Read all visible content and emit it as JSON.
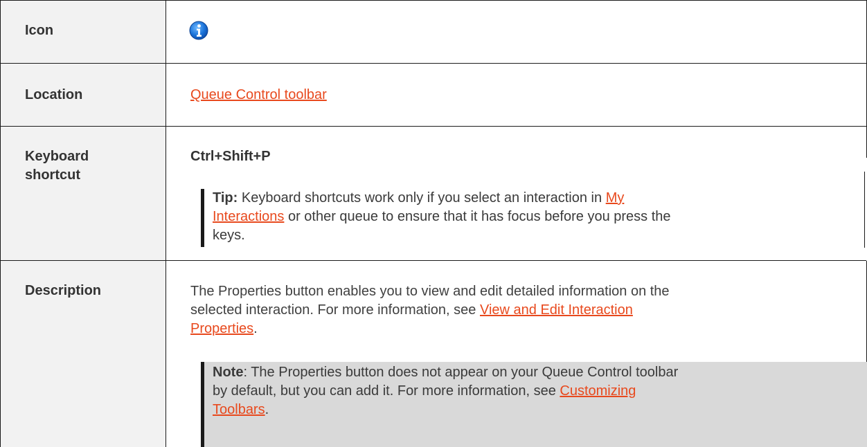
{
  "rows": {
    "icon": {
      "label": "Icon",
      "icon_name": "info-icon"
    },
    "location": {
      "label": "Location",
      "link": "Queue Control toolbar"
    },
    "shortcut": {
      "label_line1": "Keyboard",
      "label_line2": "shortcut",
      "keys": "Ctrl+Shift+P",
      "tip_label": "Tip:",
      "tip_text_1": "Keyboard shortcuts work only if you select an interaction in",
      "tip_link_1": "My",
      "tip_link_2": "Interactions",
      "tip_text_2": "or other queue to ensure that it has focus before you press the",
      "tip_text_3": "keys."
    },
    "description": {
      "label": "Description",
      "text_1": "The Properties button enables you to view and edit detailed information on the",
      "text_2": "selected interaction. For more information, see",
      "link_1": "View and Edit Interaction",
      "link_2": "Properties",
      "period": ".",
      "note_label": "Note",
      "note_text_1": ": The Properties button does not appear on your Queue Control toolbar",
      "note_text_2": "by default, but you can add it. For more information, see",
      "note_link_1": "Customizing",
      "note_link_2": "Toolbars",
      "note_period": "."
    }
  },
  "colors": {
    "link": "#e8491d",
    "header_bg": "#f2f2f2",
    "note_bg": "#d9d9d9",
    "border": "#1a1a1a",
    "icon_blue": "#1a73d9"
  }
}
